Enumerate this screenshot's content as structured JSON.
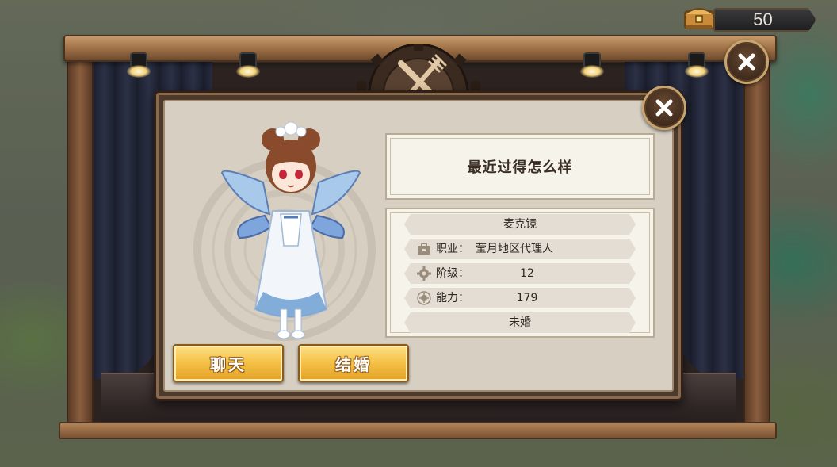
{
  "currency": {
    "value": "50",
    "icon": "treasure-chest-icon"
  },
  "dialog": {
    "speech": "最近过得怎么样",
    "character": {
      "name": "麦克镜",
      "job_label": "职业：",
      "job_value": "莹月地区代理人",
      "rank_label": "阶级：",
      "rank_value": "12",
      "ability_label": "能力：",
      "ability_value": "179",
      "marital_status": "未婚"
    },
    "buttons": {
      "chat_label": "聊天",
      "marry_label": "结婚"
    },
    "icons": {
      "job": "briefcase-icon",
      "rank": "gear-icon",
      "ability": "sun-icon",
      "close": "close-icon"
    }
  },
  "colors": {
    "button_gold": "#f5c349",
    "panel_cream": "#f6f3ea",
    "frame_brown": "#4e3a2b",
    "text_dark": "#3a2e25"
  }
}
